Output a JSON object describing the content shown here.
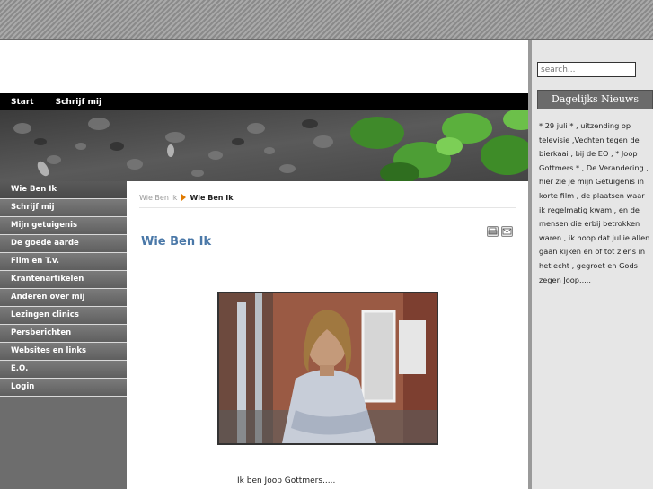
{
  "top_nav": {
    "items": [
      "Start",
      "Schrijf mij"
    ]
  },
  "sidebar": {
    "items": [
      "Wie Ben Ik",
      "Schrijf mij",
      "Mijn getuigenis",
      "De goede aarde",
      "Film en T.v.",
      "Krantenartikelen",
      "Anderen over mij",
      "Lezingen clinics",
      "Persberichten",
      "Websites en links",
      "E.O.",
      "Login"
    ]
  },
  "breadcrumb": {
    "parent": "Wie Ben Ik",
    "current": "Wie Ben Ik"
  },
  "main": {
    "title": "Wie Ben Ik",
    "caption": "Ik ben Joop Gottmers....."
  },
  "right": {
    "search_placeholder": "search...",
    "news_header": "Dagelijks Nieuws",
    "news_text": "* 29 juli * , uitzending op televisie ,Vechten tegen de bierkaai , bij de EO , * Joop Gottmers * , De Verandering , hier zie je mijn Getuigenis in korte film , de plaatsen waar ik regelmatig kwam , en de mensen die erbij betrokken waren , ik hoop dat jullie allen gaan kijken en of tot ziens in het echt , gegroet en Gods zegen Joop....."
  },
  "icons": [
    "print-icon",
    "email-icon"
  ]
}
